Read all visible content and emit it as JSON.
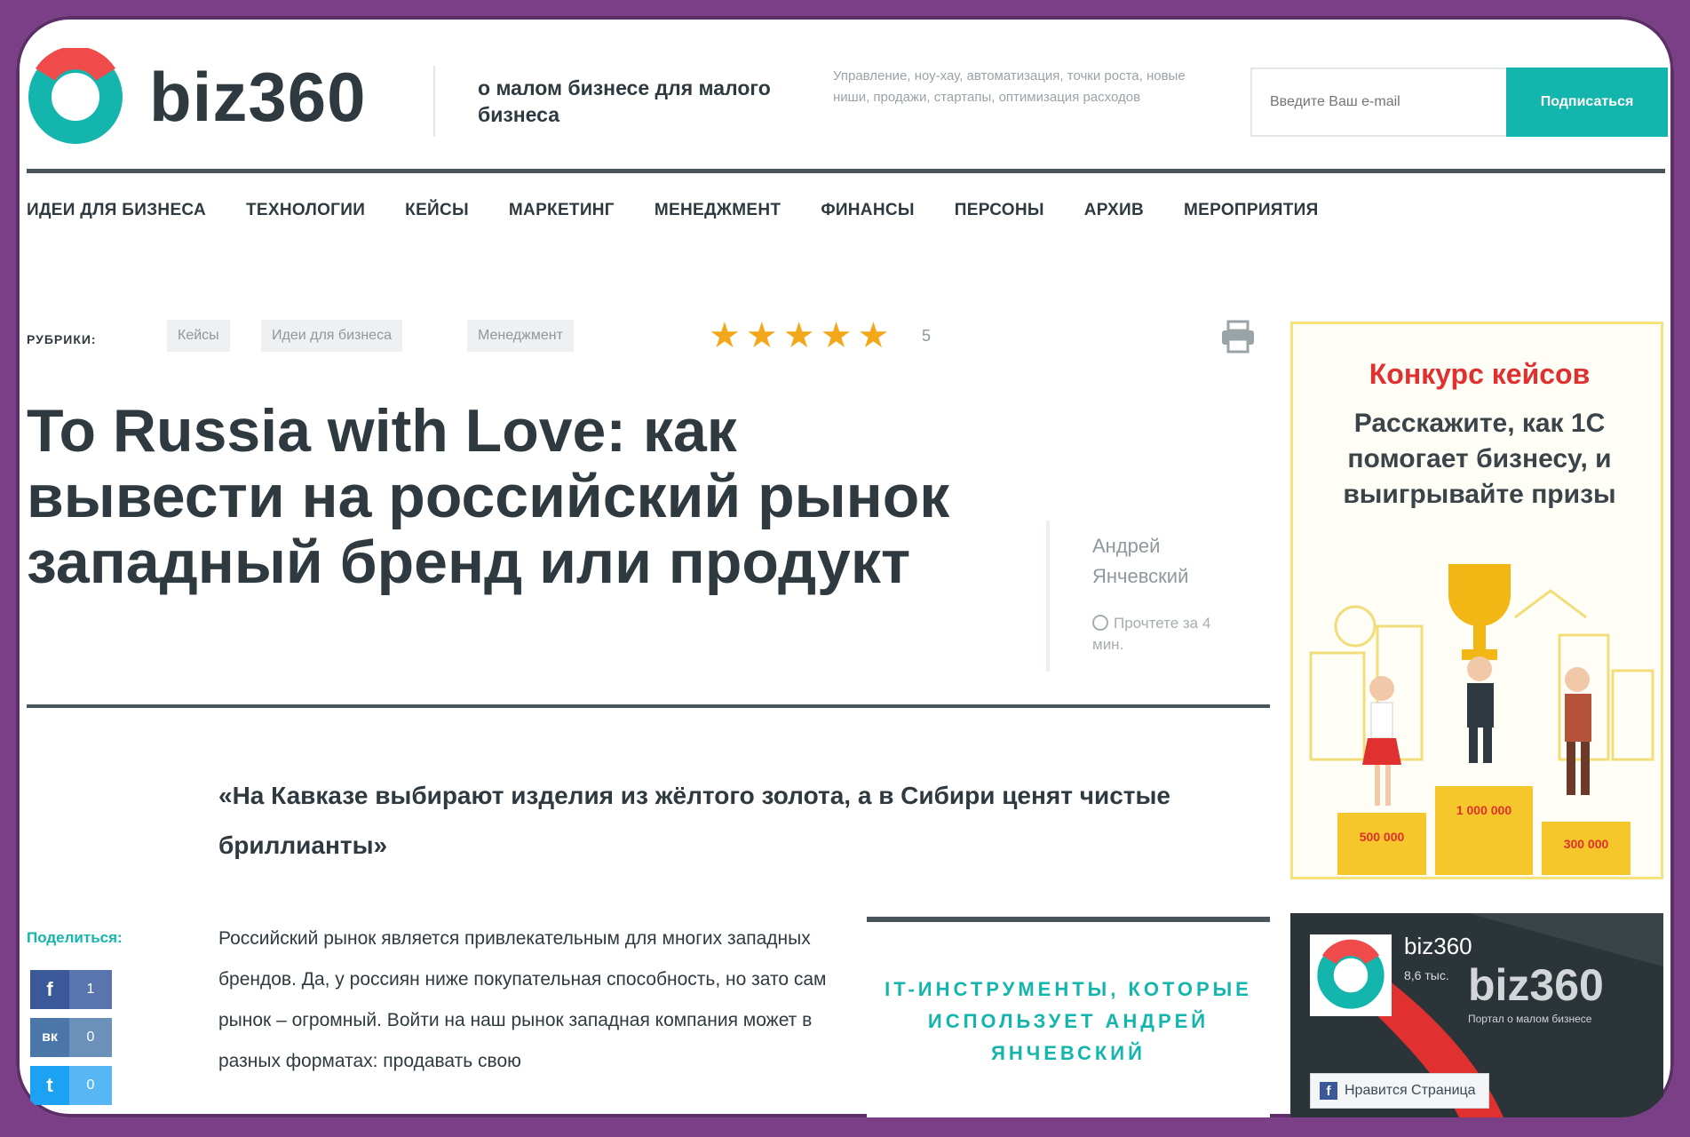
{
  "header": {
    "brand": "biz360",
    "tagline": "о малом бизнесе для малого бизнеса",
    "topics": "Управление, ноу-хау, автоматизация, точки роста, новые ниши, продажи, стартапы, оптимизация расходов",
    "email_placeholder": "Введите Ваш e-mail",
    "subscribe_label": "Подписаться"
  },
  "nav": {
    "items": [
      "ИДЕИ ДЛЯ БИЗНЕСА",
      "ТЕХНОЛОГИИ",
      "КЕЙСЫ",
      "МАРКЕТИНГ",
      "МЕНЕДЖМЕНТ",
      "ФИНАНСЫ",
      "ПЕРСОНЫ",
      "АРХИВ",
      "МЕРОПРИЯТИЯ"
    ]
  },
  "article": {
    "rubrics_label": "РУБРИКИ:",
    "rubrics": [
      "Кейсы",
      "Идеи для бизнеса",
      "Менеджмент"
    ],
    "rating": 5,
    "rating_count": "5",
    "title": "To Russia with Love: как вывести на российский рынок западный бренд или продукт",
    "author": "Андрей Янчевский",
    "read_time": "Прочтете за 4 мин.",
    "lead": "«На Кавказе выбирают изделия из жёлтого золота, а в Сибири ценят чистые бриллианты»",
    "body": "Российский рынок является привлекательным для многих западных брендов. Да, у россиян ниже покупательная способность, но зато сам рынок – огромный. Войти на наш рынок западная компания может в разных форматах: продавать свою",
    "inset": "IT-ИНСТРУМЕНТЫ, КОТОРЫЕ ИСПОЛЬЗУЕТ АНДРЕЙ ЯНЧЕВСКИЙ"
  },
  "share": {
    "label": "Поделиться:",
    "buttons": [
      {
        "icon": "f",
        "count": "1",
        "color": "#3b5998"
      },
      {
        "icon": "вк",
        "count": "0",
        "color": "#4a76a8"
      },
      {
        "icon": "t",
        "count": "0",
        "color": "#1da1f2"
      }
    ]
  },
  "banner": {
    "title": "Конкурс кейсов",
    "subtitle": "Расскажите, как 1С помогает бизнесу, и выигрывайте призы",
    "prizes": [
      "500 000",
      "1 000 000",
      "300 000"
    ]
  },
  "fb_widget": {
    "name": "biz360",
    "stats": "8,6 тыс.",
    "big_name": "biz360",
    "desc": "Портал о малом бизнесе",
    "like_label": "Нравится Страница"
  },
  "colors": {
    "accent": "#13b5ad",
    "dark": "#2f3a40",
    "star": "#f3a81c",
    "banner_title": "#e0302f",
    "frame": "#7a3f86"
  }
}
